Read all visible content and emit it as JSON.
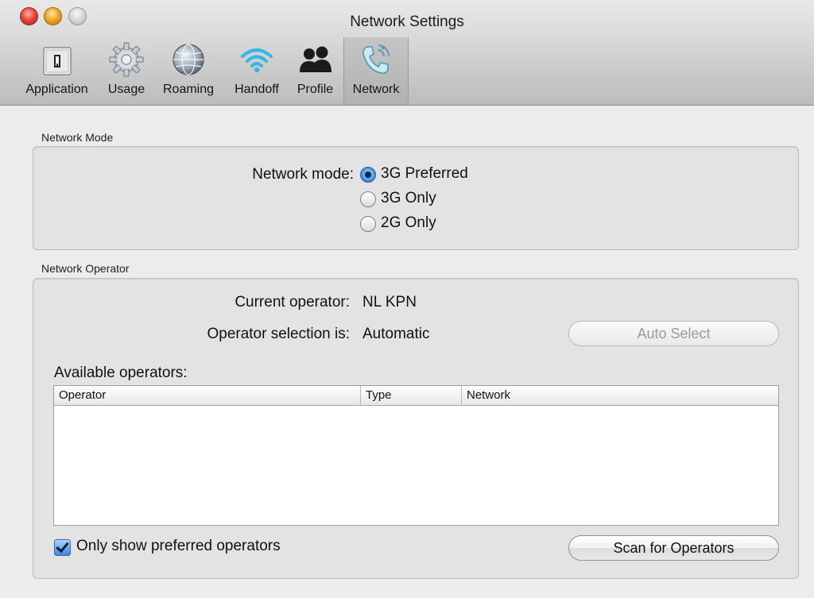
{
  "window": {
    "title": "Network Settings"
  },
  "toolbar": {
    "items": [
      {
        "label": "Application",
        "icon": "application-icon"
      },
      {
        "label": "Usage",
        "icon": "gear-icon"
      },
      {
        "label": "Roaming",
        "icon": "globe-icon"
      },
      {
        "label": "Handoff",
        "icon": "wifi-icon"
      },
      {
        "label": "Profile",
        "icon": "people-icon"
      },
      {
        "label": "Network",
        "icon": "phone-icon",
        "selected": true
      }
    ]
  },
  "network_mode": {
    "section_title": "Network Mode",
    "label": "Network mode:",
    "options": [
      {
        "label": "3G Preferred",
        "selected": true
      },
      {
        "label": "3G Only",
        "selected": false
      },
      {
        "label": "2G Only",
        "selected": false
      }
    ]
  },
  "network_operator": {
    "section_title": "Network Operator",
    "current_label": "Current operator:",
    "current_value": "NL KPN",
    "selection_label": "Operator selection is:",
    "selection_value": "Automatic",
    "auto_select_button": "Auto Select",
    "available_label": "Available operators:",
    "columns": [
      "Operator",
      "Type",
      "Network"
    ],
    "rows": [],
    "only_preferred_label": "Only show preferred operators",
    "only_preferred_checked": true,
    "scan_button": "Scan for Operators"
  }
}
